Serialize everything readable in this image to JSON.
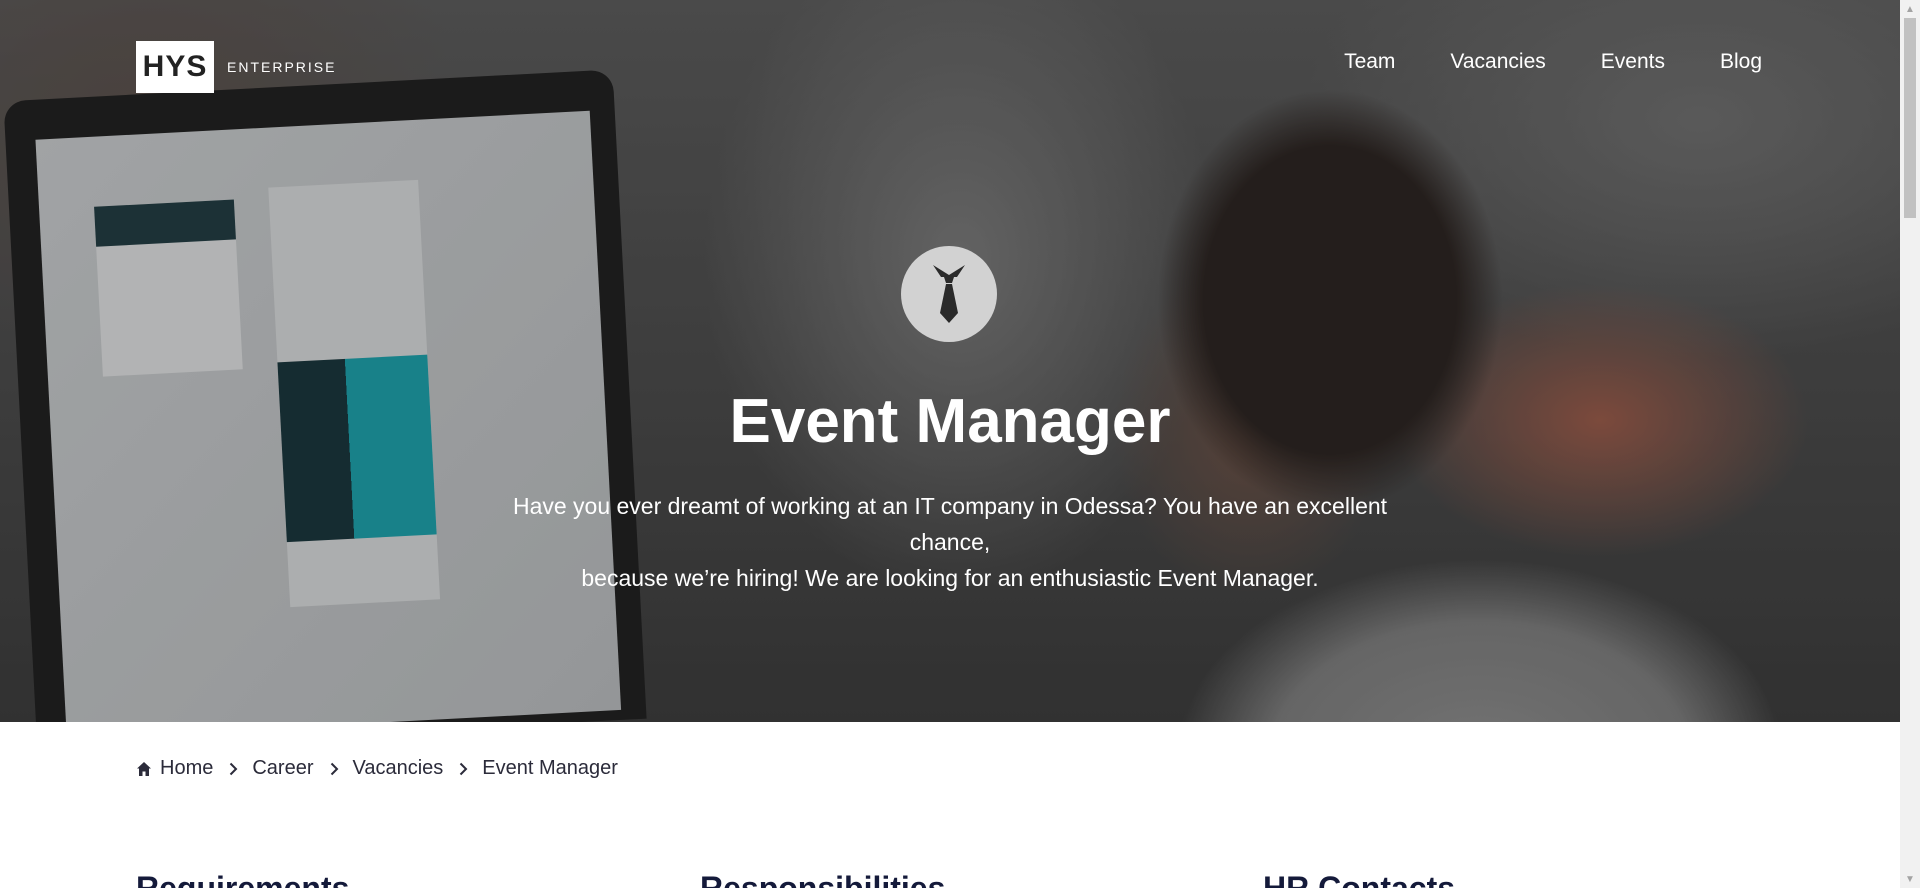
{
  "header": {
    "logo_mark": "HYS",
    "logo_text": "ENTERPRISE",
    "nav": [
      {
        "label": "Team"
      },
      {
        "label": "Vacancies"
      },
      {
        "label": "Events"
      },
      {
        "label": "Blog"
      }
    ]
  },
  "hero": {
    "icon": "tie-icon",
    "title": "Event Manager",
    "description_line1": "Have you ever dreamt of working at an IT company in Odessa? You have an excellent chance,",
    "description_line2": "because we’re hiring! We are looking for an enthusiastic Event Manager."
  },
  "breadcrumb": {
    "items": [
      "Home",
      "Career",
      "Vacancies",
      "Event Manager"
    ]
  },
  "sections": {
    "requirements": "Requirements",
    "responsibilities": "Responsibilities",
    "hr_contacts": "HR Contacts"
  },
  "colors": {
    "heading": "#141a3a",
    "text_dark": "#2b2b3a",
    "icon_circle": "#d2d2d2"
  }
}
